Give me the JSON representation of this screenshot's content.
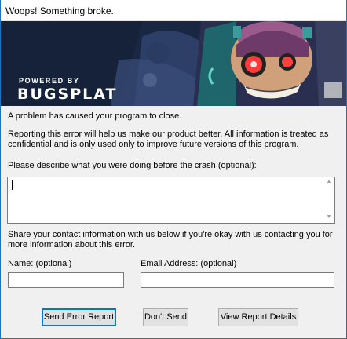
{
  "window": {
    "title": "Woops! Something broke."
  },
  "banner": {
    "powered_by": "POWERED BY",
    "brand": "BUGSPLAT"
  },
  "messages": {
    "closed": "A problem has caused your program to close.",
    "reporting": "Reporting this error will help us make our product better. All information is treated as confidential and is only used only to improve future versions of this program.",
    "describe_prompt": "Please describe what you were doing before the crash (optional):",
    "contact_prompt": "Share your contact information with us below if you're okay with us contacting you for more information about this error."
  },
  "form": {
    "description_value": "",
    "name_label": "Name: (optional)",
    "name_value": "",
    "email_label": "Email Address: (optional)",
    "email_value": ""
  },
  "buttons": {
    "send": "Send Error Report",
    "dont_send": "Don't Send",
    "details": "View Report Details"
  },
  "colors": {
    "window_border": "#1e73be",
    "default_button_border": "#0078d7"
  }
}
